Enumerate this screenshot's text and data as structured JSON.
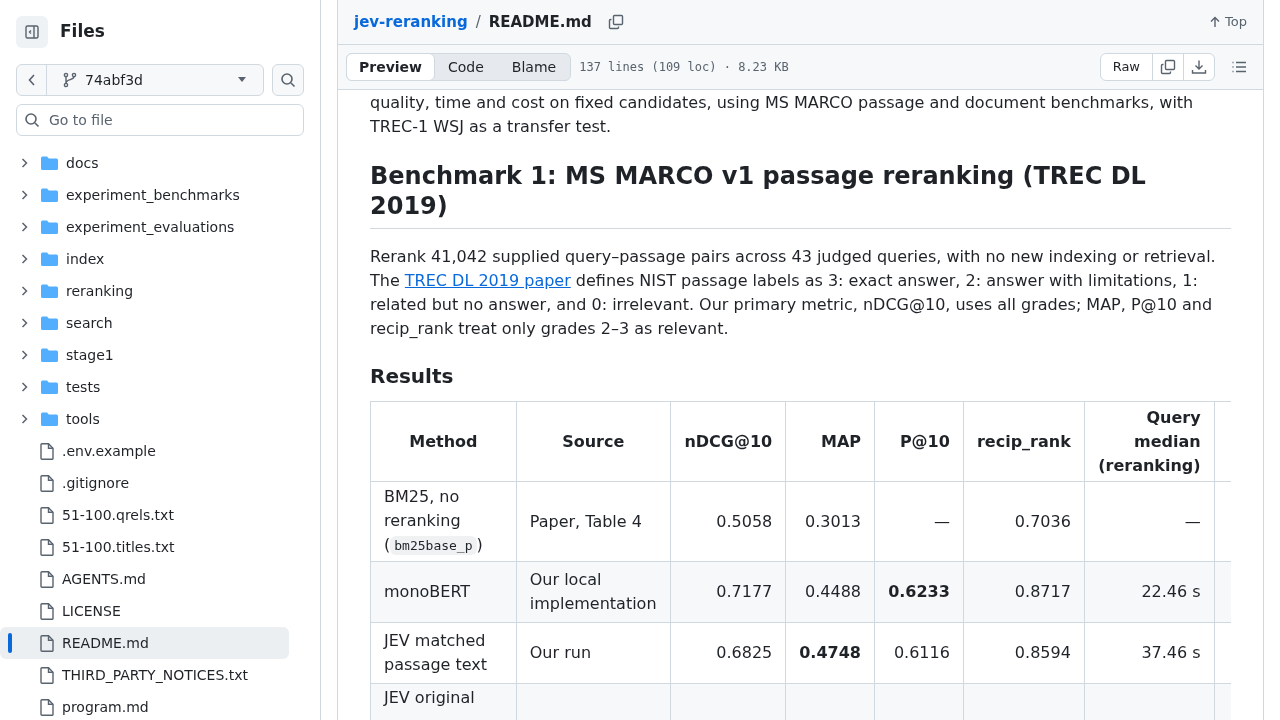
{
  "sidebar": {
    "title": "Files",
    "branch": "74abf3d",
    "search": {
      "placeholder": "Go to file"
    },
    "items": [
      {
        "kind": "folder",
        "label": "docs",
        "expanded": false,
        "selected": false
      },
      {
        "kind": "folder",
        "label": "experiment_benchmarks",
        "expanded": false,
        "selected": false
      },
      {
        "kind": "folder",
        "label": "experiment_evaluations",
        "expanded": false,
        "selected": false
      },
      {
        "kind": "folder",
        "label": "index",
        "expanded": false,
        "selected": false
      },
      {
        "kind": "folder",
        "label": "reranking",
        "expanded": false,
        "selected": false
      },
      {
        "kind": "folder",
        "label": "search",
        "expanded": false,
        "selected": false
      },
      {
        "kind": "folder",
        "label": "stage1",
        "expanded": false,
        "selected": false
      },
      {
        "kind": "folder",
        "label": "tests",
        "expanded": false,
        "selected": false
      },
      {
        "kind": "folder",
        "label": "tools",
        "expanded": false,
        "selected": false
      },
      {
        "kind": "file",
        "label": ".env.example",
        "selected": false
      },
      {
        "kind": "file",
        "label": ".gitignore",
        "selected": false
      },
      {
        "kind": "file",
        "label": "51-100.qrels.txt",
        "selected": false
      },
      {
        "kind": "file",
        "label": "51-100.titles.txt",
        "selected": false
      },
      {
        "kind": "file",
        "label": "AGENTS.md",
        "selected": false
      },
      {
        "kind": "file",
        "label": "LICENSE",
        "selected": false
      },
      {
        "kind": "file",
        "label": "README.md",
        "selected": true
      },
      {
        "kind": "file",
        "label": "THIRD_PARTY_NOTICES.txt",
        "selected": false
      },
      {
        "kind": "file",
        "label": "program.md",
        "selected": false
      }
    ]
  },
  "breadcrumb": {
    "repo": "jev-reranking",
    "separator": "/",
    "file": "README.md",
    "top_link": "Top"
  },
  "toolbar": {
    "tabs": [
      {
        "label": "Preview",
        "selected": true
      },
      {
        "label": "Code",
        "selected": false
      },
      {
        "label": "Blame",
        "selected": false
      }
    ],
    "file_info": "137 lines (109 loc) · 8.23 KB",
    "raw_button": "Raw"
  },
  "content": {
    "intro_tail": "quality, time and cost on fixed candidates, using MS MARCO passage and document benchmarks, with TREC-1 WSJ as a transfer test.",
    "heading": "Benchmark 1: MS MARCO v1 passage reranking (TREC DL 2019)",
    "paragraph": {
      "before": "Rerank 41,042 supplied query–passage pairs across 43 judged queries, with no new indexing or retrieval. The ",
      "link": "TREC DL 2019 paper",
      "after": " defines NIST passage labels as 3: exact answer, 2: answer with limitations, 1: related but no answer, and 0: irrelevant. Our primary metric, nDCG@10, uses all grades; MAP, P@10 and recip_rank treat only grades 2–3 as relevant."
    },
    "subheading": "Results",
    "table": {
      "columns": [
        "Method",
        "Source",
        "nDCG@10",
        "MAP",
        "P@10",
        "recip_rank",
        "Query median (reranking)"
      ],
      "rows": [
        {
          "cells": [
            {
              "text": "BM25, no reranking (",
              "code": "bm25base_p",
              "text_after": ")",
              "bold": false
            },
            {
              "text": "Paper, Table 4",
              "bold": false
            },
            {
              "text": "0.5058",
              "bold": false
            },
            {
              "text": "0.3013",
              "bold": false
            },
            {
              "text": "—",
              "bold": false
            },
            {
              "text": "0.7036",
              "bold": false
            },
            {
              "text": "—",
              "bold": false
            }
          ]
        },
        {
          "cells": [
            {
              "text": "monoBERT",
              "bold": false
            },
            {
              "text": "Our local implementation",
              "bold": false
            },
            {
              "text": "0.7177",
              "bold": false
            },
            {
              "text": "0.4488",
              "bold": false
            },
            {
              "text": "0.6233",
              "bold": true
            },
            {
              "text": "0.8717",
              "bold": false
            },
            {
              "text": "22.46 s",
              "bold": false
            }
          ]
        },
        {
          "cells": [
            {
              "text": "JEV matched passage text",
              "bold": false
            },
            {
              "text": "Our run",
              "bold": false
            },
            {
              "text": "0.6825",
              "bold": false
            },
            {
              "text": "0.4748",
              "bold": true
            },
            {
              "text": "0.6116",
              "bold": false
            },
            {
              "text": "0.8594",
              "bold": false
            },
            {
              "text": "37.46 s",
              "bold": false
            }
          ]
        },
        {
          "cells": [
            {
              "text": "JEV original",
              "bold": false
            }
          ]
        }
      ]
    }
  }
}
